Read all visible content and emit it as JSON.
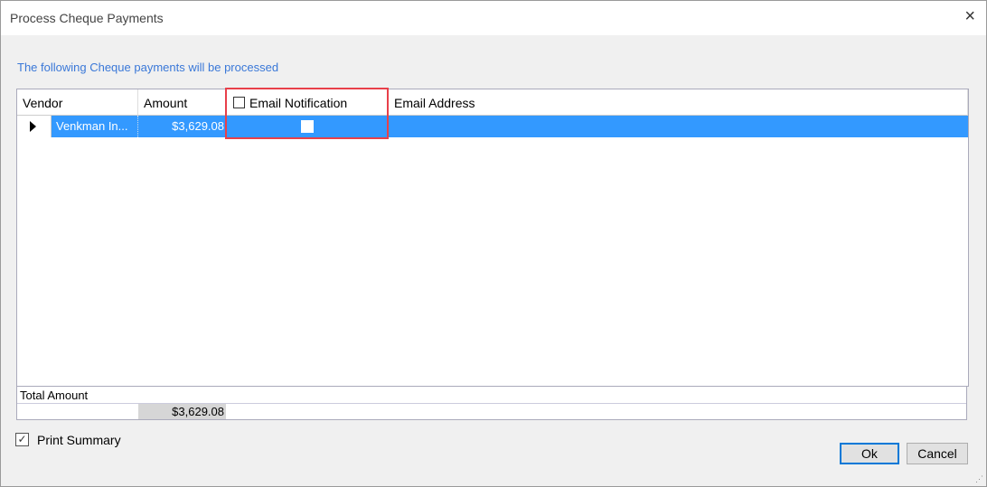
{
  "window": {
    "title": "Process Cheque Payments",
    "close_icon": "×"
  },
  "subtitle": "The following Cheque payments will be processed",
  "colors": {
    "accent": "#3399ff",
    "subtitle": "#3a78d8",
    "highlight": "#e8404a"
  },
  "grid": {
    "columns": [
      "Vendor",
      "Amount",
      "Email Notification",
      "Email Address"
    ],
    "header_checkbox_checked": false,
    "rows": [
      {
        "vendor": "Venkman In...",
        "amount": "$3,629.08",
        "email_notification": false,
        "email_address": ""
      }
    ]
  },
  "totals": {
    "label": "Total Amount",
    "amount": "$3,629.08"
  },
  "print_summary": {
    "label": "Print Summary",
    "checked": true
  },
  "buttons": {
    "ok": "Ok",
    "cancel": "Cancel"
  }
}
